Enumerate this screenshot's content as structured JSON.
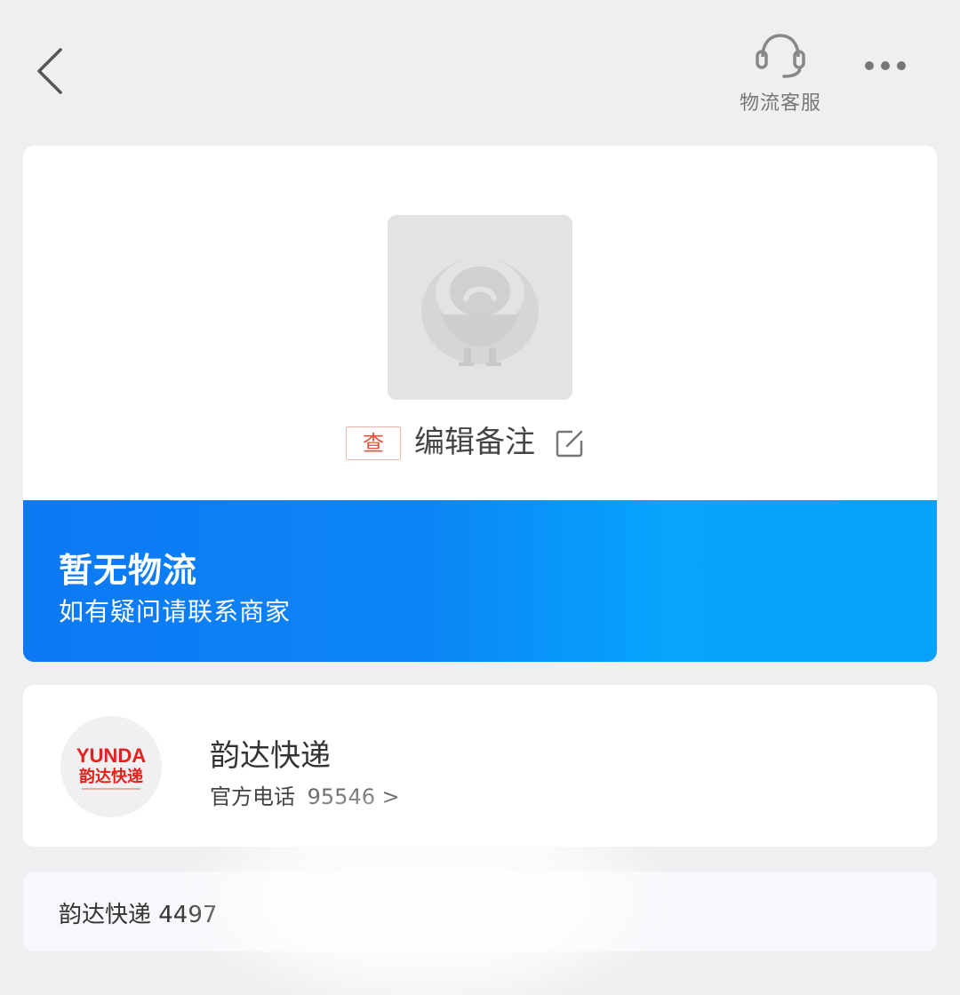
{
  "header": {
    "service_label": "物流客服",
    "icons": {
      "back": "chevron-left-icon",
      "service": "headset-icon",
      "more": "more-dots-icon"
    }
  },
  "package": {
    "image_icon": "placeholder-mascot-icon",
    "badge": "查",
    "remark_label": "编辑备注",
    "edit_icon": "edit-icon"
  },
  "status": {
    "title": "暂无物流",
    "subtitle": "如有疑问请联系商家",
    "gradient": [
      "#0d79f4",
      "#06a4fc"
    ]
  },
  "carrier": {
    "logo_text": "YUNDA",
    "logo_cn": "韵达快递",
    "logo_color": "#e0231e",
    "name": "韵达快递",
    "phone_label": "官方电话",
    "phone_number": "95546",
    "phone_arrow": ">"
  },
  "tracking": {
    "text": "韵达快递 4497"
  }
}
